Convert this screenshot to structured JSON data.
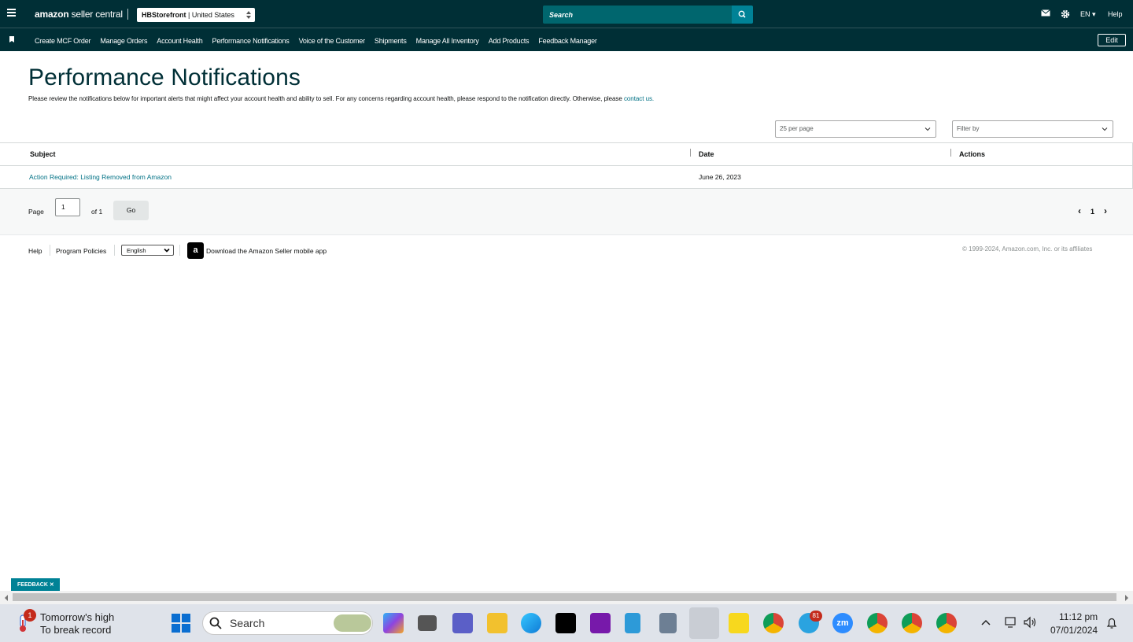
{
  "header": {
    "logo_brand": "amazon",
    "logo_suffix": "seller central",
    "store_name": "HBStorefront",
    "store_marketplace": "| United States",
    "search_placeholder": "Search",
    "lang": "EN ▾",
    "help": "Help"
  },
  "nav": {
    "items": [
      "Create MCF Order",
      "Manage Orders",
      "Account Health",
      "Performance Notifications",
      "Voice of the Customer",
      "Shipments",
      "Manage All Inventory",
      "Add Products",
      "Feedback Manager"
    ],
    "edit": "Edit"
  },
  "main": {
    "title": "Performance Notifications",
    "description": "Please review the notifications below for important alerts that might affect your account health and ability to sell. For any concerns regarding account health, please respond to the notification directly. Otherwise, please",
    "contact_link": "contact us.",
    "per_page": "25 per page",
    "filter_placeholder": "Filter by"
  },
  "table": {
    "columns": [
      "Subject",
      "Date",
      "Actions"
    ],
    "rows": [
      {
        "subject": "Action Required: Listing Removed from Amazon",
        "date": "June 26, 2023",
        "actions": ""
      }
    ]
  },
  "pager": {
    "page_label": "Page",
    "page_value": "1",
    "of_label": "of 1",
    "go": "Go",
    "current": "1",
    "prev": "‹",
    "next": "›"
  },
  "footer": {
    "help": "Help",
    "program_policies": "Program Policies",
    "language": "English",
    "app_text": "Download the Amazon Seller mobile app",
    "copyright": "© 1999-2024, Amazon.com, Inc. or its affiliates"
  },
  "feedback": "FEEDBACK ✕",
  "taskbar": {
    "weather_badge": "1",
    "weather_line1": "Tomorrow's high",
    "weather_line2": "To break record",
    "search": "Search",
    "telegram_badge": "81",
    "time": "11:12 pm",
    "date": "07/01/2024"
  }
}
